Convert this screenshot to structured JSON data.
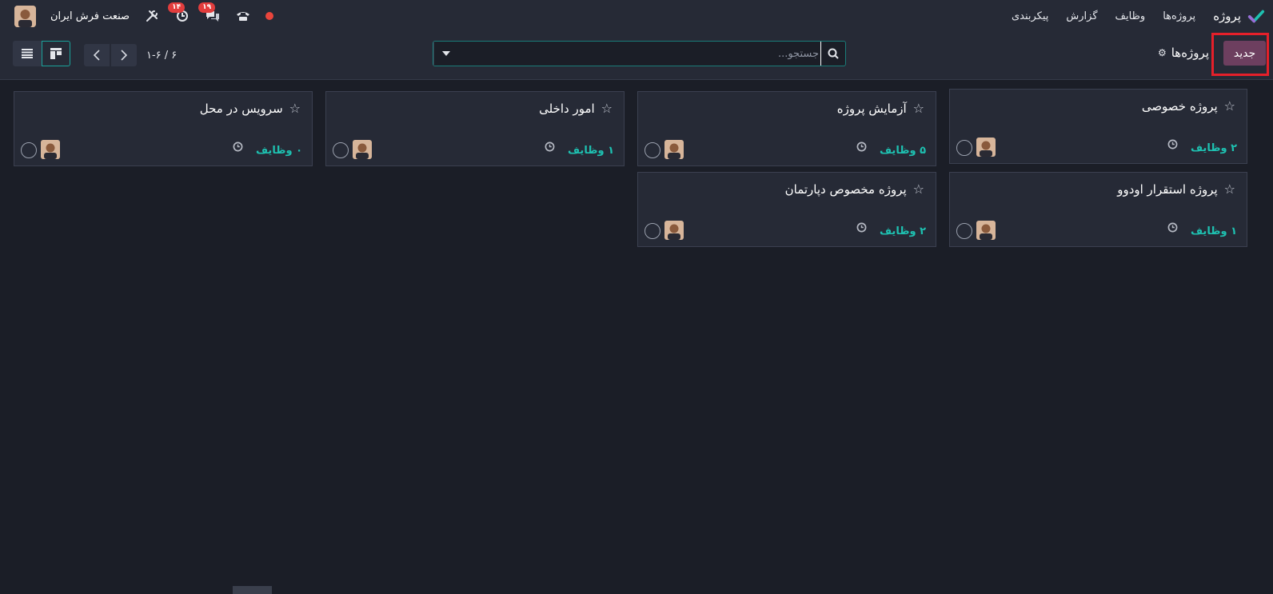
{
  "navbar": {
    "app_name": "پروژه",
    "menu": [
      "پروژه‌ها",
      "وظایف",
      "گزارش",
      "پیکربندی"
    ],
    "company": "صنعت فرش ایران",
    "activity_badge": "۱۴",
    "chat_badge": "۱۹"
  },
  "control": {
    "new_label": "جدید",
    "breadcrumb": "پروژه‌ها",
    "search_placeholder": "جستجو...",
    "pager": "۱-۶ / ۶"
  },
  "projects": [
    {
      "name": "پروژه خصوصی",
      "tasks": "۲ وظایف"
    },
    {
      "name": "آزمایش پروژه",
      "tasks": "۵ وظایف"
    },
    {
      "name": "امور داخلی",
      "tasks": "۱ وظایف"
    },
    {
      "name": "سرویس در محل",
      "tasks": "۰ وظایف"
    },
    {
      "name": "پروژه استقرار اودوو",
      "tasks": "۱ وظایف"
    },
    {
      "name": "پروژه مخصوص دپارتمان",
      "tasks": "۲ وظایف"
    }
  ],
  "colors": {
    "accent": "#1ec1b1",
    "primary_button": "#6d3f5f",
    "highlight_box": "#e5202a",
    "background": "#1b1e27",
    "panel": "#262a36"
  }
}
